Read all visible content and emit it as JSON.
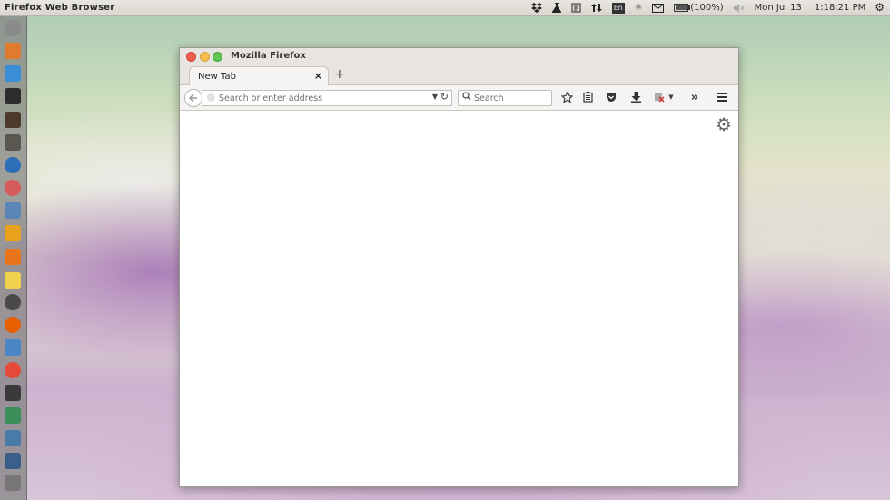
{
  "panel": {
    "app_title": "Firefox Web Browser",
    "keyboard_layout": "En",
    "battery": "(100%)",
    "date": "Mon Jul 13",
    "time": "1:18:21 PM"
  },
  "launcher": {
    "items": [
      {
        "name": "dash-home-icon",
        "color": "#8a8a8a"
      },
      {
        "name": "files-icon",
        "color": "#e07a2e"
      },
      {
        "name": "folder-icon",
        "color": "#3a8fd8"
      },
      {
        "name": "terminal-icon",
        "color": "#2c2c2c"
      },
      {
        "name": "star-app-icon",
        "color": "#4b3a2a"
      },
      {
        "name": "sublime-text-icon",
        "color": "#5a5650"
      },
      {
        "name": "globe-app-icon",
        "color": "#2c6fb8"
      },
      {
        "name": "eye-app-icon",
        "color": "#d65b5b"
      },
      {
        "name": "search-app-icon",
        "color": "#5a86b5"
      },
      {
        "name": "pencil-app-icon",
        "color": "#e8a21e"
      },
      {
        "name": "ubuntu-software-icon",
        "color": "#e8741c"
      },
      {
        "name": "notes-icon",
        "color": "#f1d24c"
      },
      {
        "name": "software-center-icon",
        "color": "#4a4a4a"
      },
      {
        "name": "firefox-icon",
        "color": "#e66000"
      },
      {
        "name": "android-icon",
        "color": "#4a86c8"
      },
      {
        "name": "red-circle-app-icon",
        "color": "#e44a3a"
      },
      {
        "name": "eye-watch-icon",
        "color": "#3a3a3a"
      },
      {
        "name": "checkmark-app-icon",
        "color": "#3a8f5a"
      },
      {
        "name": "server-icon",
        "color": "#4a7aa8"
      },
      {
        "name": "printer-icon",
        "color": "#3a5f8a"
      },
      {
        "name": "trash-icon",
        "color": "#777777"
      }
    ]
  },
  "window": {
    "title": "Mozilla Firefox",
    "tab_label": "New Tab",
    "tab_close": "×",
    "new_tab": "+",
    "url_placeholder": "Search or enter address",
    "search_placeholder": "Search"
  }
}
